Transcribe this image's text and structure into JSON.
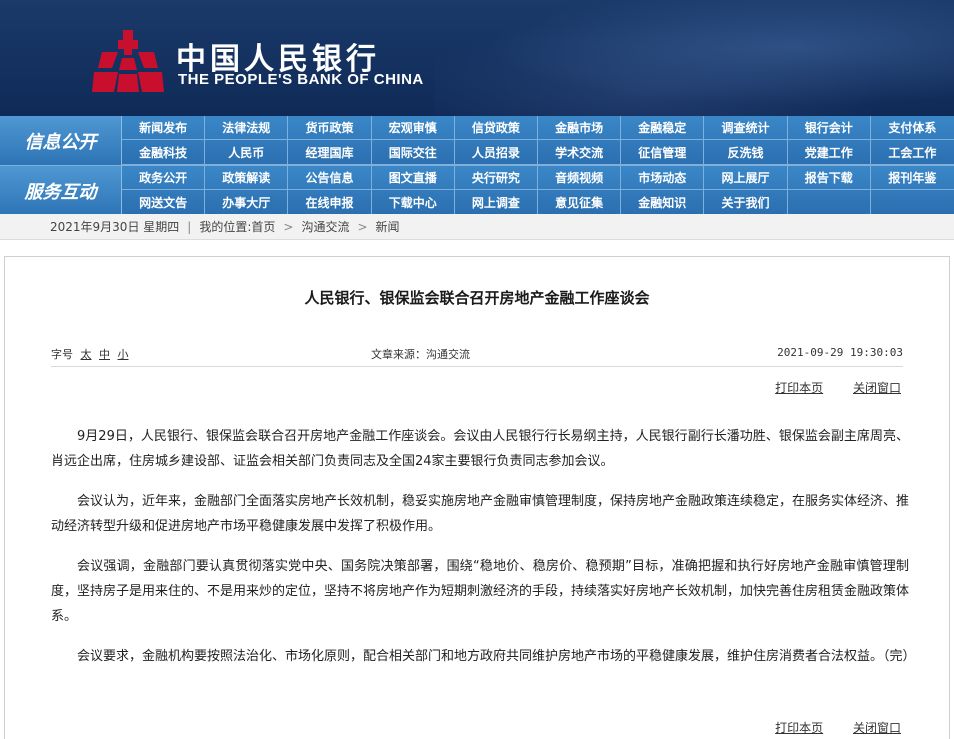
{
  "header": {
    "logo_cn": "中国人民银行",
    "logo_en": "THE PEOPLE'S BANK OF CHINA",
    "brand_color": "#c8102e"
  },
  "nav": {
    "sections": [
      {
        "title": "信息公开",
        "items": [
          "新闻发布",
          "法律法规",
          "货币政策",
          "宏观审慎",
          "信贷政策",
          "金融市场",
          "金融稳定",
          "调查统计",
          "银行会计",
          "支付体系",
          "金融科技",
          "人民币",
          "经理国库",
          "国际交往",
          "人员招录",
          "学术交流",
          "征信管理",
          "反洗钱",
          "党建工作",
          "工会工作"
        ]
      },
      {
        "title": "服务互动",
        "items": [
          "政务公开",
          "政策解读",
          "公告信息",
          "图文直播",
          "央行研究",
          "音频视频",
          "市场动态",
          "网上展厅",
          "报告下载",
          "报刊年鉴",
          "网送文告",
          "办事大厅",
          "在线申报",
          "下载中心",
          "网上调查",
          "意见征集",
          "金融知识",
          "关于我们",
          "",
          ""
        ]
      }
    ]
  },
  "breadcrumb": {
    "date": "2021年9月30日 星期四",
    "location_label": "我的位置:",
    "home": "首页",
    "section": "沟通交流",
    "current": "新闻",
    "separator": "|",
    "arrow": ">"
  },
  "article": {
    "title": "人民银行、银保监会联合召开房地产金融工作座谈会",
    "font_size_label": "字号",
    "font_sizes": [
      "太",
      "中",
      "小"
    ],
    "source": "文章来源：沟通交流",
    "datetime": "2021-09-29 19:30:03",
    "print_label": "打印本页",
    "close_label": "关闭窗口",
    "paragraphs": [
      "9月29日，人民银行、银保监会联合召开房地产金融工作座谈会。会议由人民银行行长易纲主持，人民银行副行长潘功胜、银保监会副主席周亮、肖远企出席，住房城乡建设部、证监会相关部门负责同志及全国24家主要银行负责同志参加会议。",
      "会议认为，近年来，金融部门全面落实房地产长效机制，稳妥实施房地产金融审慎管理制度，保持房地产金融政策连续稳定，在服务实体经济、推动经济转型升级和促进房地产市场平稳健康发展中发挥了积极作用。",
      "会议强调，金融部门要认真贯彻落实党中央、国务院决策部署，围绕“稳地价、稳房价、稳预期”目标，准确把握和执行好房地产金融审慎管理制度，坚持房子是用来住的、不是用来炒的定位，坚持不将房地产作为短期刺激经济的手段，持续落实好房地产长效机制，加快完善住房租赁金融政策体系。",
      "会议要求，金融机构要按照法治化、市场化原则，配合相关部门和地方政府共同维护房地产市场的平稳健康发展，维护住房消费者合法权益。（完）"
    ]
  }
}
